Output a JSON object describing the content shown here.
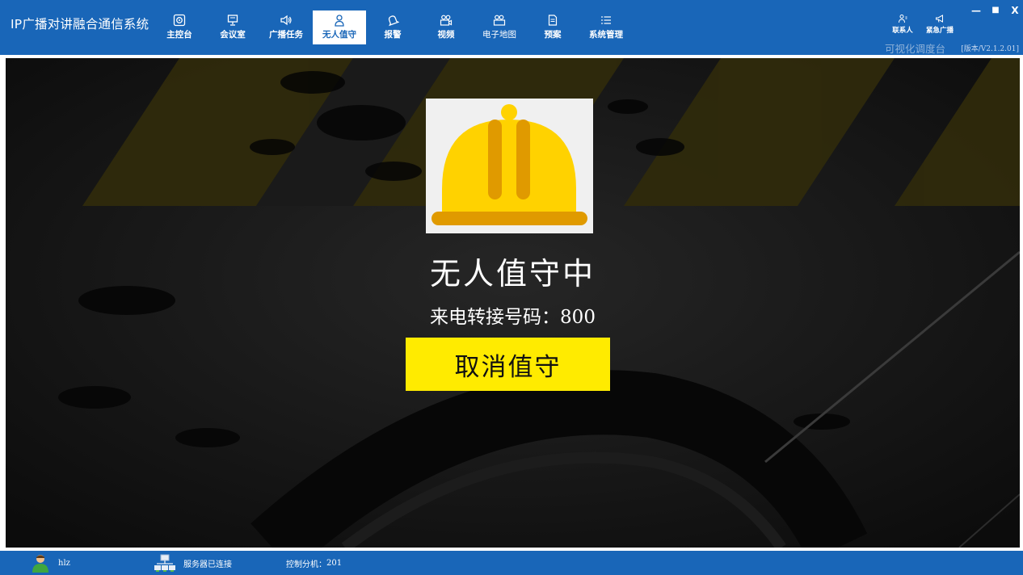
{
  "app": {
    "title": "IP广播对讲融合通信系统",
    "dispatch_label": "可视化调度台",
    "version": "[版本/V2.1.2.01]"
  },
  "nav": {
    "items": [
      {
        "label": "主控台",
        "icon": "dashboard-icon"
      },
      {
        "label": "会议室",
        "icon": "meeting-icon"
      },
      {
        "label": "广播任务",
        "icon": "speaker-icon"
      },
      {
        "label": "无人值守",
        "icon": "user-icon",
        "active": true
      },
      {
        "label": "报警",
        "icon": "alarm-bell-icon"
      },
      {
        "label": "视频",
        "icon": "video-icon"
      },
      {
        "label": "电子地图",
        "icon": "map-icon"
      },
      {
        "label": "预案",
        "icon": "document-icon"
      },
      {
        "label": "系统管理",
        "icon": "list-icon"
      }
    ]
  },
  "quick_actions": {
    "contacts": "联系人",
    "emergency_broadcast": "紧急广播"
  },
  "window_controls": {
    "minimize": "—",
    "maximize": "■",
    "close": "X"
  },
  "main": {
    "status_title": "无人值守中",
    "forward_label": "来电转接号码：",
    "forward_number": "800",
    "cancel_button": "取消值守",
    "helmet_icon": "hard-hat-icon"
  },
  "status_bar": {
    "user": "hlz",
    "server_status": "服务器已连接",
    "extension_label": "控制分机：",
    "extension_number": "201"
  },
  "colors": {
    "header_blue": "#1966b8",
    "background_dark": "#141414",
    "button_yellow": "#ffeb00",
    "helmet_yellow": "#ffd200",
    "helmet_orange": "#e09a00"
  }
}
